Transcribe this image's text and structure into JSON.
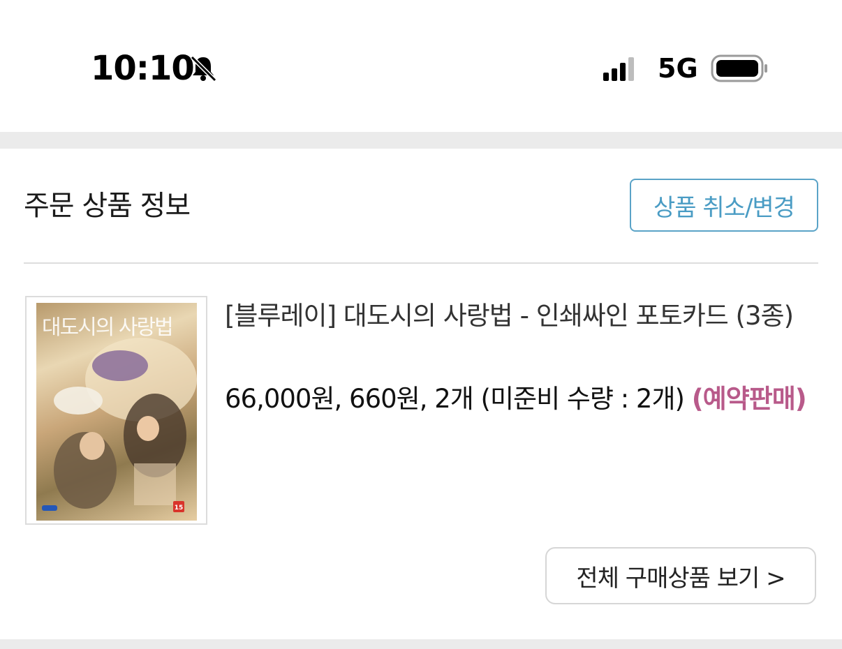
{
  "status_bar": {
    "time": "10:10",
    "network": "5G",
    "icons": [
      "bell-slash-icon",
      "cellular-signal-icon",
      "battery-icon"
    ]
  },
  "order_section": {
    "title": "주문 상품 정보",
    "cancel_change_button": "상품 취소/변경",
    "accent_color": "#4a9cc4"
  },
  "product": {
    "cover_title": "대도시의 사랑법",
    "cover_rating_label": "15",
    "name": "[블루레이] 대도시의 사랑법 - 인쇄싸인 포토카드 (3종)",
    "price_summary": "66,000원, 660원, 2개 (미준비 수량 : 2개)",
    "sale_status": "(예약판매)",
    "sale_status_color": "#b85a8a"
  },
  "footer": {
    "view_all_button": "전체 구매상품 보기 >"
  }
}
